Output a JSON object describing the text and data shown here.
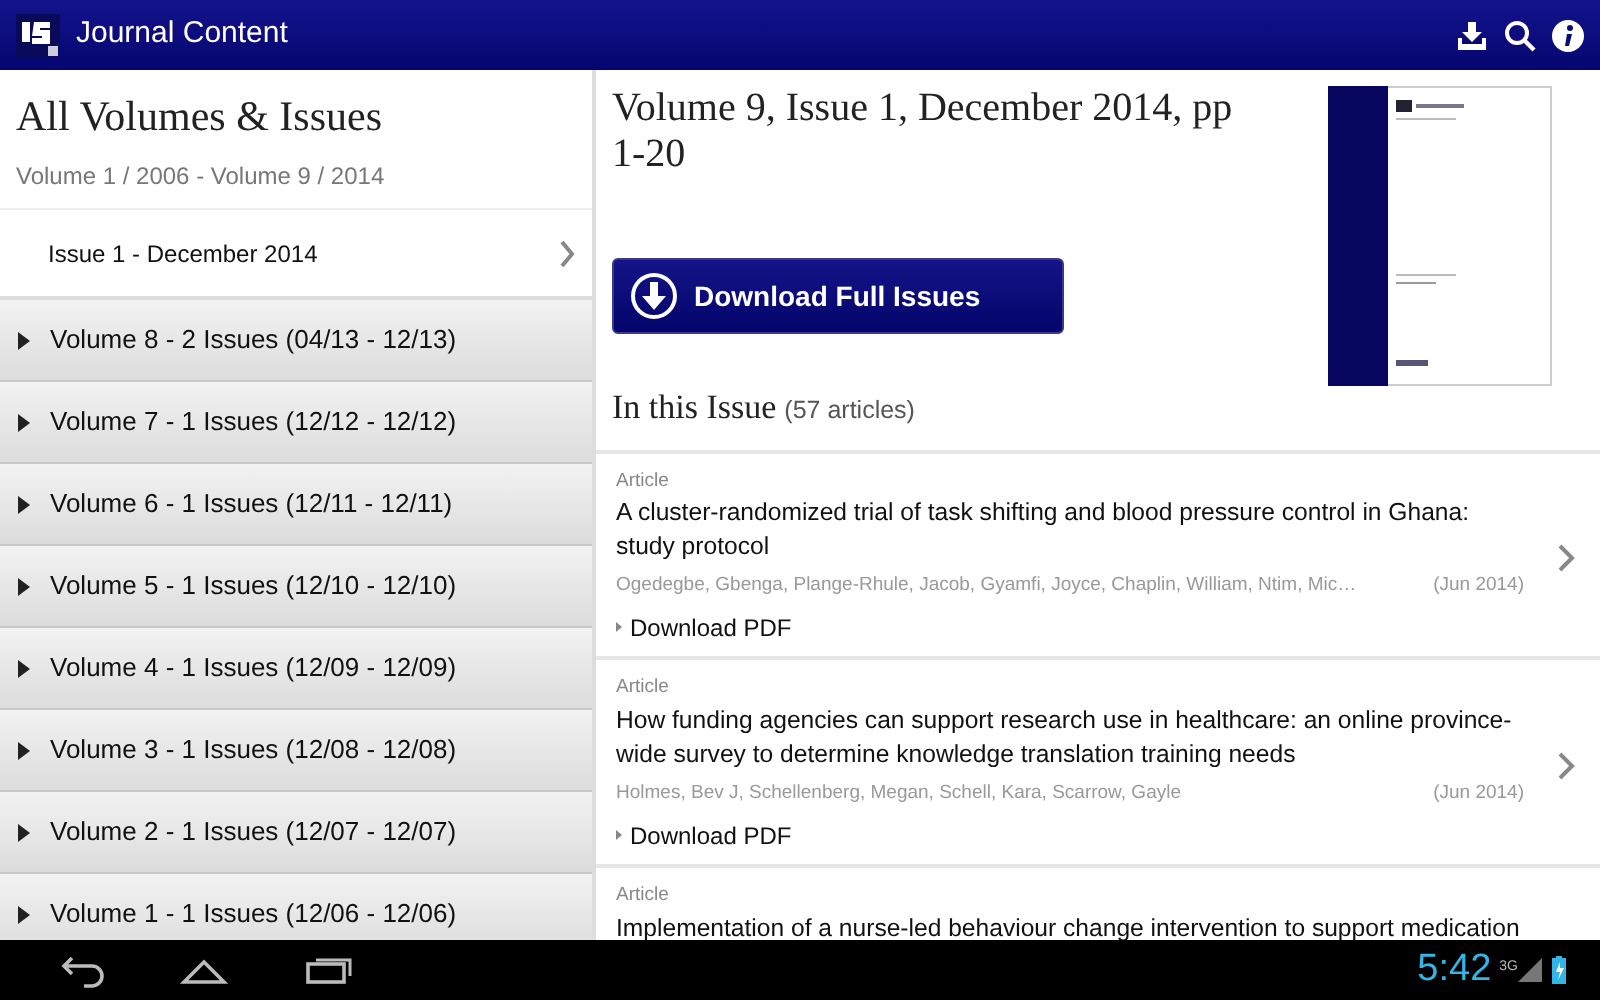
{
  "app_bar": {
    "title": "Journal Content"
  },
  "sidebar": {
    "title": "All Volumes & Issues",
    "subtitle": "Volume 1 / 2006 - Volume 9 / 2014",
    "issues": [
      {
        "label": "Issue 1 - December 2014"
      }
    ],
    "volumes": [
      {
        "label": "Volume 8 - 2 Issues (04/13 - 12/13)",
        "expanded": false
      },
      {
        "label": "Volume 7 - 1 Issues (12/12 - 12/12)",
        "expanded": false
      },
      {
        "label": "Volume 6 - 1 Issues (12/11 - 12/11)",
        "expanded": false
      },
      {
        "label": "Volume 5 - 1 Issues (12/10 - 12/10)",
        "expanded": false
      },
      {
        "label": "Volume 4 - 1 Issues (12/09 - 12/09)",
        "expanded": false
      },
      {
        "label": "Volume 3 - 1 Issues (12/08 - 12/08)",
        "expanded": false
      },
      {
        "label": "Volume 2 - 1 Issues (12/07 - 12/07)",
        "expanded": false
      },
      {
        "label": "Volume 1 - 1 Issues (12/06 - 12/06)",
        "expanded": false
      }
    ]
  },
  "issue": {
    "title": "Volume 9, Issue 1, December 2014, pp 1-20",
    "download_button": "Download Full Issues",
    "section_title": "In this Issue",
    "article_count": "(57 articles)",
    "articles": [
      {
        "type": "Article",
        "title": "A cluster-randomized trial of task shifting and blood pressure control in Ghana: study protocol",
        "authors": "Ogedegbe, Gbenga, Plange-Rhule, Jacob, Gyamfi, Joyce, Chaplin, William, Ntim, Mic…",
        "date": "(Jun 2014)",
        "download": "Download PDF"
      },
      {
        "type": "Article",
        "title": "How funding agencies can support research use in healthcare: an online province-wide survey to determine knowledge translation training needs",
        "authors": "Holmes, Bev J, Schellenberg, Megan, Schell, Kara, Scarrow, Gayle",
        "date": "(Jun 2014)",
        "download": "Download PDF"
      },
      {
        "type": "Article",
        "title": "Implementation of a nurse-led behaviour change intervention to support medication"
      }
    ]
  },
  "status_bar": {
    "time": "5:42",
    "network": "3G"
  }
}
